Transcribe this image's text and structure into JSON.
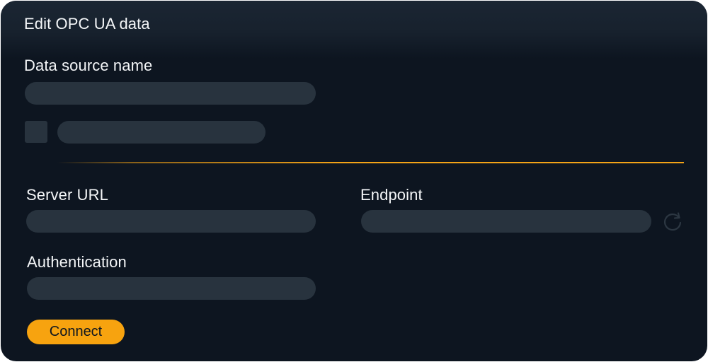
{
  "dialog": {
    "title": "Edit OPC UA data"
  },
  "fields": {
    "data_source_name_label": "Data source name",
    "server_url_label": "Server URL",
    "endpoint_label": "Endpoint",
    "authentication_label": "Authentication"
  },
  "actions": {
    "connect_label": "Connect",
    "refresh_icon": "refresh-icon"
  },
  "colors": {
    "background": "#0d1520",
    "field": "#28333e",
    "accent": "#f7a30f",
    "text": "#f4f6f8"
  }
}
